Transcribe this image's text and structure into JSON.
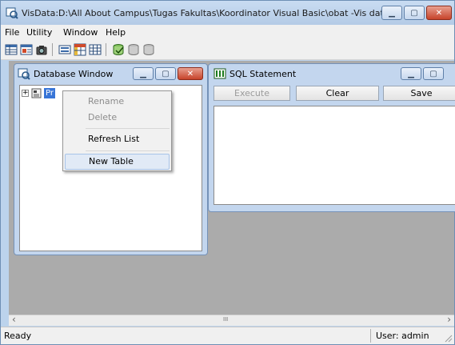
{
  "app": {
    "title": "VisData:D:\\All About Campus\\Tugas Fakultas\\Koordinator Visual Basic\\obat -Vis data\\..."
  },
  "menu": [
    "File",
    "Utility",
    "Window",
    "Help"
  ],
  "toolbar_icons": [
    "table-type-icon",
    "dynaset-type-icon",
    "snapshot-type-icon",
    "data-control-icon",
    "dbgrid-icon",
    "grid-icon",
    "begin-transaction-icon",
    "commit-icon",
    "rollback-icon"
  ],
  "database_window": {
    "title": "Database Window",
    "tree_node": "Pr"
  },
  "context_menu": {
    "items": [
      {
        "label": "Rename",
        "enabled": false
      },
      {
        "label": "Delete",
        "enabled": false
      },
      {
        "label": "Refresh List",
        "enabled": true
      },
      {
        "label": "New Table",
        "enabled": true,
        "highlighted": true
      }
    ]
  },
  "sql_window": {
    "title": "SQL Statement",
    "buttons": [
      {
        "label": "Execute",
        "enabled": false
      },
      {
        "label": "Clear",
        "enabled": true
      },
      {
        "label": "Save",
        "enabled": true
      }
    ]
  },
  "status": {
    "left": "Ready",
    "user": "User: admin"
  },
  "scroll": {
    "left_arrow": "‹",
    "right_arrow": "›",
    "grip": "III"
  }
}
